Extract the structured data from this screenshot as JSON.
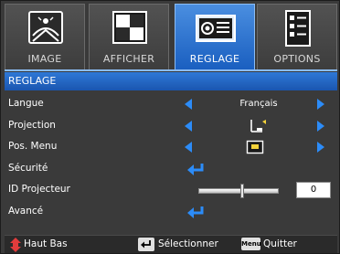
{
  "tabs": [
    {
      "label": "IMAGE",
      "icon": "image-icon"
    },
    {
      "label": "AFFICHER",
      "icon": "display-icon"
    },
    {
      "label": "REGLAGE",
      "icon": "projector-icon",
      "active": true
    },
    {
      "label": "OPTIONS",
      "icon": "checklist-icon"
    }
  ],
  "section_title": "REGLAGE",
  "rows": [
    {
      "label": "Langue",
      "value": "Français",
      "control": "arrows"
    },
    {
      "label": "Projection",
      "value_icon": "projection-front-icon",
      "control": "arrows"
    },
    {
      "label": "Pos. Menu",
      "value_icon": "menu-position-icon",
      "control": "arrows"
    },
    {
      "label": "Sécurité",
      "control": "enter"
    },
    {
      "label": "ID Projecteur",
      "value": "0",
      "control": "slider",
      "level": 0.54
    },
    {
      "label": "Avancé",
      "control": "enter"
    }
  ],
  "footer": {
    "nav_label": "Haut Bas",
    "select_label": "Sélectionner",
    "menu_key": "Menu",
    "quit_label": "Quitter"
  },
  "colors": {
    "accent_blue": "#2c8cf8",
    "header_blue": "#1a56b0",
    "background": "#3a3a3a",
    "nav_red": "#e23c3c"
  }
}
